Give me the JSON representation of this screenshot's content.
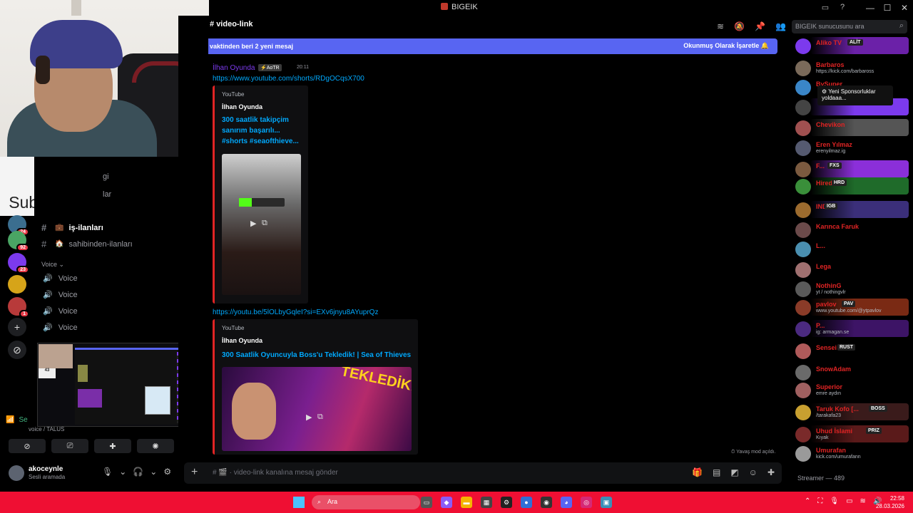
{
  "window": {
    "title": "BIGEIK"
  },
  "overlay": {
    "subscriber_count": "43",
    "subscriber_label": "Subscribers"
  },
  "servers": [
    {
      "badge": "24",
      "color": "#3b6e8f"
    },
    {
      "badge": "92",
      "color": "#4aa564"
    },
    {
      "badge": "23",
      "color": "#7c3aed"
    },
    {
      "badge": "",
      "color": "#d6a419"
    },
    {
      "badge": "1",
      "color": "#b83a3a"
    }
  ],
  "channels": {
    "partial_1": "gi",
    "partial_2": "lar",
    "active": {
      "name": "iş-ilanları"
    },
    "sahibinden": {
      "name": "sahibinden-ilanları"
    },
    "voice_category": "Voice",
    "voice_channels": [
      "Voice",
      "Voice",
      "Voice",
      "Voice"
    ]
  },
  "voice_status": {
    "label": "Se",
    "sub": "voice / TALUS"
  },
  "user": {
    "name": "akoceynle",
    "status": "Sesli aramada"
  },
  "chat": {
    "channel_name": "video-link",
    "new_message_bar": "vaktinden beri 2 yeni mesaj",
    "mark_read": "Okunmuş Olarak İşaretle",
    "author": "İlhan Oyunda",
    "author_badge": "AoTR",
    "time": "20:11",
    "link1": "https://www.youtube.com/shorts/RDgOCqsX700",
    "embed1": {
      "source": "YouTube",
      "author": "İlhan Oyunda",
      "title": "300 saatlik takipçim sanırım başarılı... #shorts #seaofthieve..."
    },
    "link2": "https://youtu.be/5lOLbyGqleI?si=EXv6jnyu8AYuprQz",
    "embed2": {
      "source": "YouTube",
      "author": "İlhan Oyunda",
      "title": "300 Saatlik Oyuncuyla Boss'u Tekledik! | Sea of Thieves",
      "thumb_text": "TEKLEDİK!"
    },
    "slowmode": "Yavaş mod açıldı.",
    "input_placeholder": "video-link kanalına mesaj gönder"
  },
  "search": {
    "placeholder": "BIGEIK sunucusunu ara"
  },
  "members": [
    {
      "name": "Aliko TV",
      "tag": "ALİT",
      "status": "",
      "bg": "#6b21a8"
    },
    {
      "name": "Barbaros",
      "tag": "",
      "status": "https://kick.com/barbaross",
      "bg": ""
    },
    {
      "name": "BySuper",
      "tag": "",
      "status": "",
      "bg": ""
    },
    {
      "name": "",
      "tag": "",
      "status": "",
      "bg": "#7c3aed"
    },
    {
      "name": "Chevikon",
      "tag": "",
      "status": "",
      "bg": "#555"
    },
    {
      "name": "Eren Yılmaz",
      "tag": "",
      "status": "erenyilmaz.ig",
      "bg": ""
    },
    {
      "name": "F...",
      "tag": "FXS",
      "status": "",
      "bg": "#8b2fd9"
    },
    {
      "name": "Hired",
      "tag": "HRD",
      "status": "",
      "bg": "#1f6b2a"
    },
    {
      "name": "INDIE",
      "tag": "IGB",
      "status": "",
      "bg": "#3b2f7a"
    },
    {
      "name": "Karınca Faruk",
      "tag": "",
      "status": "",
      "bg": ""
    },
    {
      "name": "L...",
      "tag": "",
      "status": "",
      "bg": ""
    },
    {
      "name": "Lega",
      "tag": "",
      "status": "",
      "bg": ""
    },
    {
      "name": "NothinG",
      "tag": "",
      "status": "yt / nothingvlr",
      "bg": ""
    },
    {
      "name": "pavlov",
      "tag": "PAV",
      "status": "www.youtube.com/@ytpavlov",
      "bg": "#7a2a14"
    },
    {
      "name": "P...",
      "tag": "",
      "status": "ig: armagan.se",
      "bg": "#3d1466"
    },
    {
      "name": "Sensei",
      "tag": "RUST",
      "status": "",
      "bg": ""
    },
    {
      "name": "SnowAdam",
      "tag": "",
      "status": "",
      "bg": ""
    },
    {
      "name": "Superior",
      "tag": "",
      "status": "emre aydın",
      "bg": ""
    },
    {
      "name": "Taruk Kofo [...",
      "tag": "BOSS",
      "status": "/tarakafa23",
      "bg": "#3a1b1b"
    },
    {
      "name": "Uhud İslami",
      "tag": "PRIZ",
      "status": "Kıyak",
      "bg": "#5a1a1a"
    },
    {
      "name": "Umurafan",
      "tag": "",
      "status": "kick.com/umurafann",
      "bg": ""
    }
  ],
  "member_tooltip": "Yeni Sponsorluklar yoldaaa...",
  "streamer_category": "Streamer — 489",
  "taskbar": {
    "search": "Ara",
    "time": "22:58",
    "date": "28.03.2026"
  }
}
